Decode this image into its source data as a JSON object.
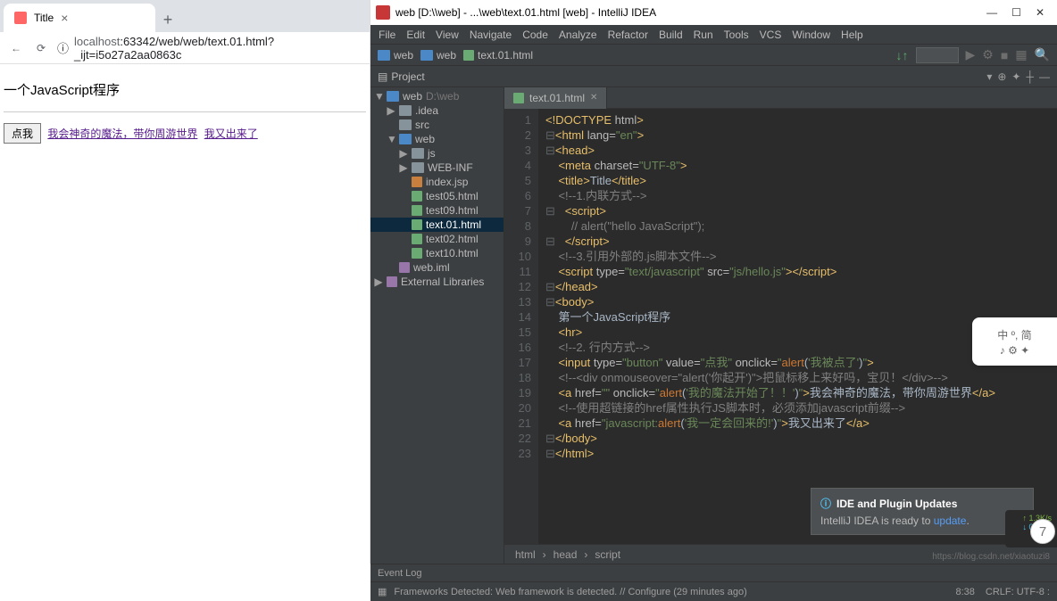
{
  "browser": {
    "tab_title": "Title",
    "url_prefix": "localhost",
    "url_rest": ":63342/web/web/text.01.html?_ijt=i5o27a2aa0863c",
    "page_heading": "一个JavaScript程序",
    "button_label": "点我",
    "link1": "我会神奇的魔法，带你周游世界",
    "link2": "我又出来了"
  },
  "ide": {
    "title": "web [D:\\\\web] - ...\\web\\text.01.html [web] - IntelliJ IDEA",
    "menus": [
      "File",
      "Edit",
      "View",
      "Navigate",
      "Code",
      "Analyze",
      "Refactor",
      "Build",
      "Run",
      "Tools",
      "VCS",
      "Window",
      "Help"
    ],
    "crumbs": [
      "web",
      "web",
      "text.01.html"
    ],
    "project_label": "Project",
    "tree": [
      {
        "lvl": 0,
        "arrow": "▼",
        "icon": "blue",
        "type": "folder",
        "label": "web",
        "extra": "D:\\web"
      },
      {
        "lvl": 1,
        "arrow": "▶",
        "icon": "gray",
        "type": "folder",
        "label": ".idea"
      },
      {
        "lvl": 1,
        "arrow": "",
        "icon": "gray",
        "type": "folder",
        "label": "src"
      },
      {
        "lvl": 1,
        "arrow": "▼",
        "icon": "blue",
        "type": "folder",
        "label": "web"
      },
      {
        "lvl": 2,
        "arrow": "▶",
        "icon": "gray",
        "type": "folder",
        "label": "js"
      },
      {
        "lvl": 2,
        "arrow": "▶",
        "icon": "gray",
        "type": "folder",
        "label": "WEB-INF"
      },
      {
        "lvl": 2,
        "arrow": "",
        "icon": "orange",
        "type": "file",
        "label": "index.jsp"
      },
      {
        "lvl": 2,
        "arrow": "",
        "icon": "green",
        "type": "file",
        "label": "test05.html"
      },
      {
        "lvl": 2,
        "arrow": "",
        "icon": "green",
        "type": "file",
        "label": "test09.html"
      },
      {
        "lvl": 2,
        "arrow": "",
        "icon": "green",
        "type": "file",
        "label": "text.01.html",
        "sel": true
      },
      {
        "lvl": 2,
        "arrow": "",
        "icon": "green",
        "type": "file",
        "label": "text02.html"
      },
      {
        "lvl": 2,
        "arrow": "",
        "icon": "green",
        "type": "file",
        "label": "text10.html"
      },
      {
        "lvl": 1,
        "arrow": "",
        "icon": "purple",
        "type": "file",
        "label": "web.iml"
      },
      {
        "lvl": 0,
        "arrow": "▶",
        "icon": "purple",
        "type": "file",
        "label": "External Libraries"
      }
    ],
    "open_tab": "text.01.html",
    "code_lines": [
      1,
      2,
      3,
      4,
      5,
      6,
      7,
      8,
      9,
      10,
      11,
      12,
      13,
      14,
      15,
      16,
      17,
      18,
      19,
      20,
      21,
      22,
      23
    ],
    "breadcrumb_bot": [
      "html",
      "head",
      "script"
    ],
    "notif_title": "IDE and Plugin Updates",
    "notif_body": "IntelliJ IDEA is ready to ",
    "notif_link": "update",
    "eventlog": "Event Log",
    "status_msg": "Frameworks Detected: Web framework is detected. // Configure (29 minutes ago)",
    "status_pos": "8:38",
    "status_enc": "CRLF:  UTF-8 :",
    "net1": "1.3K/s",
    "net2": "0.3K/s",
    "sticker": "中 º, 简",
    "sticker2": "♪ ⚙ ✦",
    "watermark": "https://blog.csdn.net/xiaotuzi8"
  }
}
